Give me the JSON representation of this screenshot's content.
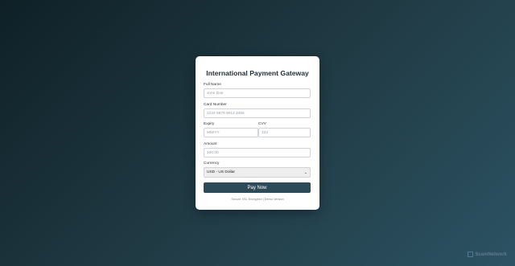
{
  "form": {
    "title": "International Payment Gateway",
    "full_name": {
      "label": "Full Name",
      "placeholder": "John Doe"
    },
    "card_number": {
      "label": "Card Number",
      "placeholder": "1234 5678 9012 3456"
    },
    "expiry": {
      "label": "Expiry",
      "placeholder": "MM/YY"
    },
    "cvv": {
      "label": "CVV",
      "placeholder": "123"
    },
    "amount": {
      "label": "Amount",
      "placeholder": "100.00"
    },
    "currency": {
      "label": "Currency",
      "selected": "USD - US Dollar"
    },
    "pay_label": "Pay Now",
    "footer": "Secure SSL Encrypted | Demo Version"
  },
  "watermark": {
    "text": "ScamNetwork",
    "icon": "brand-logo-icon"
  },
  "colors": {
    "background_start": "#0f2027",
    "background_end": "#2c5364",
    "button": "#2c4a5a"
  }
}
